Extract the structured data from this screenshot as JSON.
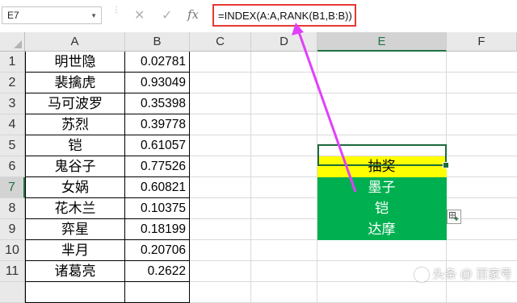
{
  "formula_bar": {
    "name_box": "E7",
    "formula": "=INDEX(A:A,RANK(B1,B:B))",
    "icons": [
      "chevron-down-icon",
      "cancel-icon",
      "enter-icon",
      "fx-icon"
    ]
  },
  "columns": [
    "A",
    "B",
    "C",
    "D",
    "E",
    "F"
  ],
  "rows": [
    "1",
    "2",
    "3",
    "4",
    "5",
    "6",
    "7",
    "8",
    "9",
    "10",
    "11"
  ],
  "column_a": [
    "明世隐",
    "裴擒虎",
    "马可波罗",
    "苏烈",
    "铠",
    "鬼谷子",
    "女娲",
    "花木兰",
    "弈星",
    "芈月",
    "诸葛亮"
  ],
  "column_b": [
    "0.02781",
    "0.93049",
    "0.35398",
    "0.39778",
    "0.61057",
    "0.77526",
    "0.60821",
    "0.10375",
    "0.18199",
    "0.20706",
    "0.2622"
  ],
  "column_e": {
    "header_label": "抽奖",
    "winners": [
      "墨子",
      "铠",
      "达摩"
    ]
  },
  "colors": {
    "header_fill": "#ffff00",
    "winner_fill": "#00b050",
    "formula_highlight": "#e53935",
    "arrow": "#e040fb",
    "selection": "#1d6b3c"
  },
  "watermark": "头条 @ 百家号"
}
